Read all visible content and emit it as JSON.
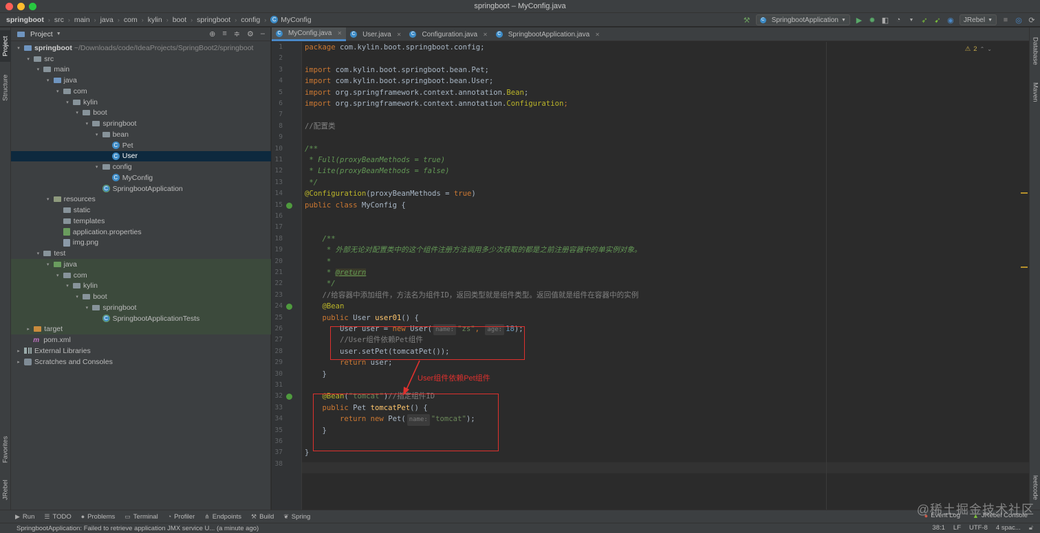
{
  "window": {
    "title": "springboot – MyConfig.java"
  },
  "colors": {
    "accent": "#4a88c7",
    "selection": "#0d293e",
    "annotation_red": "#e0312e",
    "close": "#fe5f57",
    "minimize": "#febc2e",
    "maximize": "#28c840"
  },
  "breadcrumb": [
    "springboot",
    "src",
    "main",
    "java",
    "com",
    "kylin",
    "boot",
    "springboot",
    "config",
    "MyConfig"
  ],
  "toolbar": {
    "run_config": "SpringbootApplication",
    "jrebel": "JRebel",
    "icons": [
      "hammer-icon",
      "run-icon",
      "debug-icon",
      "coverage-icon",
      "profile-icon",
      "jrebel-run-icon",
      "jrebel-debug-icon",
      "jrebel-sync-icon",
      "stop-icon",
      "search-icon",
      "update-icon"
    ]
  },
  "left_strip": {
    "project": "Project",
    "structure": "Structure",
    "favorites": "Favorites",
    "jrebel": "JRebel"
  },
  "right_strip": {
    "database": "Database",
    "maven": "Maven",
    "leetcode": "leetcode"
  },
  "project_panel": {
    "title": "Project",
    "tree": [
      {
        "label": "springboot",
        "path": "~/Downloads/code/IdeaProjects/SpringBoot2/springboot",
        "indent": 0,
        "arrow": "▾",
        "icon": "folder-blue"
      },
      {
        "label": "src",
        "indent": 1,
        "arrow": "▾",
        "icon": "folder"
      },
      {
        "label": "main",
        "indent": 2,
        "arrow": "▾",
        "icon": "folder"
      },
      {
        "label": "java",
        "indent": 3,
        "arrow": "▾",
        "icon": "folder-blue"
      },
      {
        "label": "com",
        "indent": 4,
        "arrow": "▾",
        "icon": "folder"
      },
      {
        "label": "kylin",
        "indent": 5,
        "arrow": "▾",
        "icon": "folder"
      },
      {
        "label": "boot",
        "indent": 6,
        "arrow": "▾",
        "icon": "folder"
      },
      {
        "label": "springboot",
        "indent": 7,
        "arrow": "▾",
        "icon": "folder"
      },
      {
        "label": "bean",
        "indent": 8,
        "arrow": "▾",
        "icon": "folder"
      },
      {
        "label": "Pet",
        "indent": 9,
        "arrow": "",
        "icon": "class"
      },
      {
        "label": "User",
        "indent": 9,
        "arrow": "",
        "icon": "class",
        "selected": true
      },
      {
        "label": "config",
        "indent": 8,
        "arrow": "▾",
        "icon": "folder"
      },
      {
        "label": "MyConfig",
        "indent": 9,
        "arrow": "",
        "icon": "class"
      },
      {
        "label": "SpringbootApplication",
        "indent": 8,
        "arrow": "",
        "icon": "class-spring"
      },
      {
        "label": "resources",
        "indent": 3,
        "arrow": "▾",
        "icon": "folder-res"
      },
      {
        "label": "static",
        "indent": 4,
        "arrow": "",
        "icon": "folder"
      },
      {
        "label": "templates",
        "indent": 4,
        "arrow": "",
        "icon": "folder"
      },
      {
        "label": "application.properties",
        "indent": 4,
        "arrow": "",
        "icon": "file-prop"
      },
      {
        "label": "img.png",
        "indent": 4,
        "arrow": "",
        "icon": "file-img"
      },
      {
        "label": "test",
        "indent": 2,
        "arrow": "▾",
        "icon": "folder"
      },
      {
        "label": "java",
        "indent": 3,
        "arrow": "▾",
        "icon": "folder-green",
        "test": true
      },
      {
        "label": "com",
        "indent": 4,
        "arrow": "▾",
        "icon": "folder",
        "test": true
      },
      {
        "label": "kylin",
        "indent": 5,
        "arrow": "▾",
        "icon": "folder",
        "test": true
      },
      {
        "label": "boot",
        "indent": 6,
        "arrow": "▾",
        "icon": "folder",
        "test": true
      },
      {
        "label": "springboot",
        "indent": 7,
        "arrow": "▾",
        "icon": "folder",
        "test": true
      },
      {
        "label": "SpringbootApplicationTests",
        "indent": 8,
        "arrow": "",
        "icon": "class-spring",
        "test": true
      },
      {
        "label": "target",
        "indent": 1,
        "arrow": "▸",
        "icon": "folder-orange",
        "test": true
      },
      {
        "label": "pom.xml",
        "indent": 1,
        "arrow": "",
        "icon": "maven"
      },
      {
        "label": "External Libraries",
        "indent": 0,
        "arrow": "▸",
        "icon": "lib"
      },
      {
        "label": "Scratches and Consoles",
        "indent": 0,
        "arrow": "▸",
        "icon": "scratch"
      }
    ]
  },
  "editor_tabs": [
    {
      "label": "MyConfig.java",
      "active": true
    },
    {
      "label": "User.java",
      "active": false
    },
    {
      "label": "Configuration.java",
      "active": false
    },
    {
      "label": "SpringbootApplication.java",
      "active": false
    }
  ],
  "editor": {
    "inspections": "2",
    "line_numbers": [
      "1",
      "2",
      "3",
      "4",
      "5",
      "6",
      "7",
      "8",
      "9",
      "10",
      "11",
      "12",
      "13",
      "14",
      "15",
      "16",
      "17",
      "18",
      "19",
      "20",
      "21",
      "22",
      "23",
      "24",
      "25",
      "26",
      "27",
      "28",
      "29",
      "30",
      "31",
      "32",
      "33",
      "34",
      "35",
      "36",
      "37",
      "38"
    ],
    "code": {
      "l1_kw": "package",
      "l1_rest": " com.kylin.boot.springboot.config;",
      "l3_kw": "import",
      "l3_rest": " com.kylin.boot.springboot.bean.Pet;",
      "l4_kw": "import",
      "l4_rest": " com.kylin.boot.springboot.bean.User;",
      "l5_kw": "import",
      "l5_rest": " org.springframework.context.annotation.",
      "l5_cls": "Bean",
      "l5_end": ";",
      "l6_kw": "import",
      "l6_rest": " org.springframework.context.annotation.",
      "l6_cls": "Configuration",
      "l6_end": ";",
      "l8": "//配置类",
      "l10": "/**",
      "l11": " * Full(proxyBeanMethods = true)",
      "l12": " * Lite(proxyBeanMethods = false)",
      "l13": " */",
      "l14_ann": "@Configuration",
      "l14_mid": "(proxyBeanMethods = ",
      "l14_kw": "true",
      "l14_end": ")",
      "l15_kw": "public class",
      "l15_rest": " MyConfig {",
      "l18": "    /**",
      "l19": "     * 外部无论对配置类中的这个组件注册方法调用多少次获取的都是之前注册容器中的单实例对象。",
      "l20": "     *",
      "l21_pre": "     * ",
      "l21_tag": "@return",
      "l22": "     */",
      "l23": "    //给容器中添加组件，方法名为组件ID，返回类型就是组件类型。返回值就是组件在容器中的实例",
      "l24": "    @Bean",
      "l25_kw": "    public",
      "l25_mid": " User ",
      "l25_fn": "user01",
      "l25_end": "() {",
      "l26_a": "        User user = ",
      "l26_kw": "new",
      "l26_b": " User(",
      "l26_hint1": "name:",
      "l26_str": "\"zs\"",
      "l26_c": ",",
      "l26_hint2": "age:",
      "l26_num": "18",
      "l26_end": ");",
      "l27": "        //User组件依赖Pet组件",
      "l28": "        user.setPet(tomcatPet());",
      "l29_kw": "        return",
      "l29_rest": " user;",
      "l30": "    }",
      "l32_ann": "    @Bean",
      "l32_paren": "(",
      "l32_str": "\"tomcat\"",
      "l32_close": ")",
      "l32_cmt": "//指定组件ID",
      "l33_kw": "    public",
      "l33_mid": " Pet ",
      "l33_fn": "tomcatPet",
      "l33_end": "() {",
      "l34_kw": "        return new",
      "l34_mid": " Pet(",
      "l34_hint": "name:",
      "l34_str": "\"tomcat\"",
      "l34_end": ");",
      "l35": "    }",
      "l37": "}"
    },
    "annotation_label": "User组件依赖Pet组件"
  },
  "bottom_tools": [
    {
      "label": "Run",
      "icon": "run-icon"
    },
    {
      "label": "TODO",
      "icon": "list-icon"
    },
    {
      "label": "Problems",
      "icon": "problems-icon"
    },
    {
      "label": "Terminal",
      "icon": "terminal-icon"
    },
    {
      "label": "Profiler",
      "icon": "profiler-icon"
    },
    {
      "label": "Endpoints",
      "icon": "endpoints-icon"
    },
    {
      "label": "Build",
      "icon": "hammer-icon"
    },
    {
      "label": "Spring",
      "icon": "spring-icon"
    }
  ],
  "bottom_right": {
    "event_log": "Event Log",
    "jrebel_console": "JRebel Console"
  },
  "status": {
    "message": "SpringbootApplication: Failed to retrieve application JMX service U... (a minute ago)",
    "position": "38:1",
    "line_sep": "LF",
    "encoding": "UTF-8",
    "indent": "4 spac..."
  },
  "watermark": "@稀土掘金技术社区"
}
